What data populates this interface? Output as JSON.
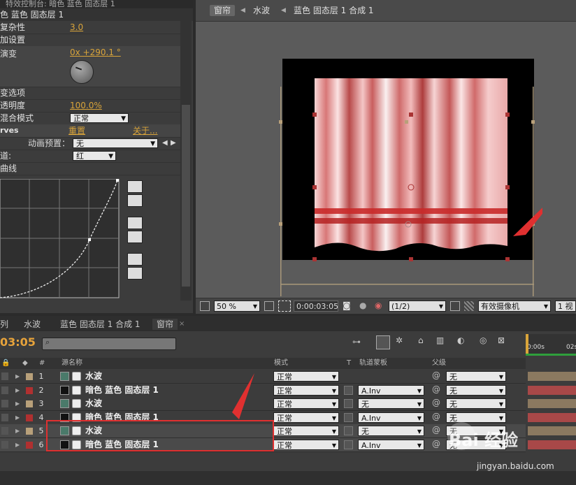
{
  "fx_panel": {
    "tab_title": "特效控制台: 暗色 蓝色 固态层 1",
    "layer_title": "色 蓝色 固态层 1",
    "rows": {
      "complexity_label": "复杂性",
      "complexity_value": "3.0",
      "extra_settings_label": "加设置",
      "evolution_label": "演变",
      "evolution_value": "0x +290.1 °",
      "evolution_options_label": "变选项",
      "opacity_label": "透明度",
      "opacity_value": "100.0%",
      "blend_mode_label": "混合模式",
      "blend_mode_value": "正常",
      "curves_label": "rves",
      "reset_link": "重置",
      "about_link": "关于...",
      "preset_label": "动画预置：",
      "preset_value": "无",
      "channel_label": "道:",
      "channel_value": "红",
      "curve_label": "曲线"
    }
  },
  "viewer": {
    "tab_label": "窗帘",
    "breadcrumb": [
      "窗帘",
      "水波",
      "蓝色 固态层 1 合成 1"
    ],
    "zoom": "50 %",
    "timecode": "0:00:03:05",
    "resolution": "(1/2)",
    "camera": "有效摄像机",
    "views": "1 视"
  },
  "timeline": {
    "tabs": [
      "列",
      "水波",
      "蓝色 固态层 1 合成 1",
      "窗帘"
    ],
    "current_time": "03:05",
    "ruler": [
      "0:00s",
      "02s"
    ],
    "columns": {
      "hash": "#",
      "source_name": "源名称",
      "mode": "模式",
      "t": "T",
      "track_matte": "轨道蒙板",
      "parent": "父级"
    },
    "layers": [
      {
        "num": "1",
        "name": "水波",
        "mode": "正常",
        "matte": "",
        "parent": "无",
        "color": "#b8a07a",
        "bar": "#8b7960"
      },
      {
        "num": "2",
        "name": "暗色 蓝色 固态层 1",
        "mode": "正常",
        "matte": "A.Inv",
        "parent": "无",
        "color": "#b03030",
        "bar": "#a84848"
      },
      {
        "num": "3",
        "name": "水波",
        "mode": "正常",
        "matte": "无",
        "parent": "无",
        "color": "#b8a07a",
        "bar": "#8b7960"
      },
      {
        "num": "4",
        "name": "暗色 蓝色 固态层 1",
        "mode": "正常",
        "matte": "A.Inv",
        "parent": "无",
        "color": "#b03030",
        "bar": "#a84848"
      },
      {
        "num": "5",
        "name": "水波",
        "mode": "正常",
        "matte": "无",
        "parent": "无",
        "color": "#b8a07a",
        "bar": "#8b7960"
      },
      {
        "num": "6",
        "name": "暗色 蓝色 固态层 1",
        "mode": "正常",
        "matte": "A.Inv",
        "parent": "无",
        "color": "#b03030",
        "bar": "#a84848"
      }
    ]
  },
  "watermark": {
    "brand": "Bai 经验",
    "url": "jingyan.baidu.com"
  },
  "colors": {
    "accent": "#e7a33b",
    "highlight_red": "#e03030"
  }
}
